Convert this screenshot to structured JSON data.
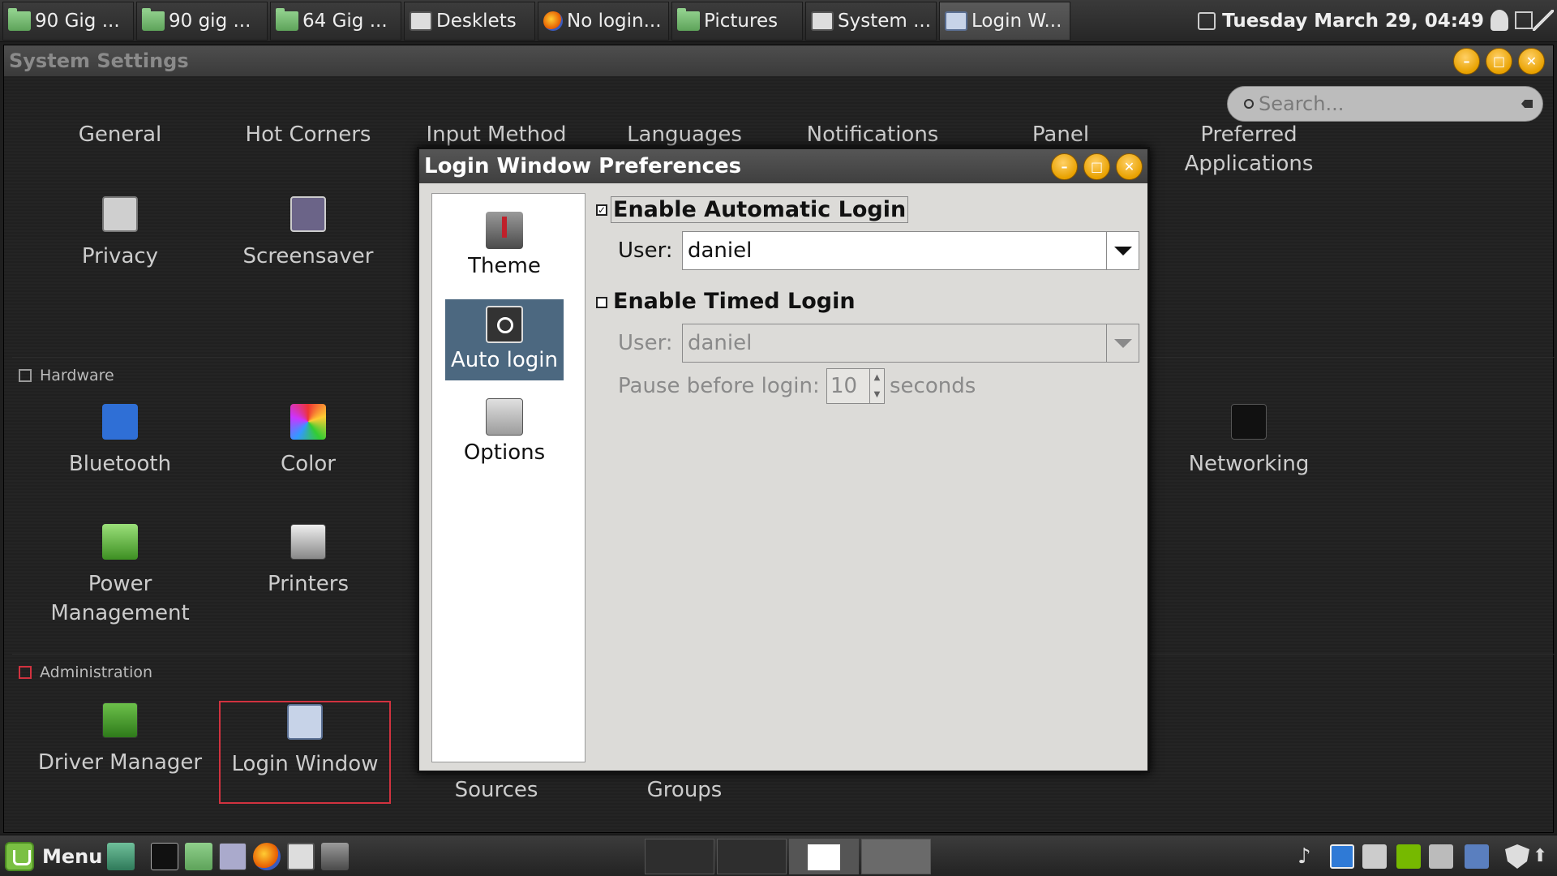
{
  "taskbar": {
    "tasks": [
      {
        "label": "90 Gig ...",
        "icon": "folder-icon"
      },
      {
        "label": "90 gig ...",
        "icon": "folder-icon"
      },
      {
        "label": "64 Gig ...",
        "icon": "folder-icon"
      },
      {
        "label": "Desklets",
        "icon": "settings-icon"
      },
      {
        "label": "No login...",
        "icon": "firefox-icon"
      },
      {
        "label": "Pictures",
        "icon": "folder-icon"
      },
      {
        "label": "System ...",
        "icon": "settings-icon"
      },
      {
        "label": "Login W...",
        "icon": "login-window-icon"
      }
    ],
    "clock": "Tuesday March 29, 04:49"
  },
  "settings": {
    "title": "System Settings",
    "search_placeholder": "Search...",
    "top_items": [
      "General",
      "Hot Corners",
      "Input Method",
      "Languages",
      "Notifications",
      "Panel",
      "Preferred Applications"
    ],
    "row2": [
      "Privacy",
      "Screensaver"
    ],
    "hardware_label": "Hardware",
    "hardware": [
      "Bluetooth",
      "Color",
      "Networking",
      "Power Management",
      "Printers"
    ],
    "admin_label": "Administration",
    "admin": [
      "Driver Manager",
      "Login Window",
      "Sources",
      "Groups"
    ]
  },
  "dialog": {
    "title": "Login Window Preferences",
    "sidebar": [
      "Theme",
      "Auto login",
      "Options"
    ],
    "auto_login_label": "Enable Automatic Login",
    "auto_login_checked": true,
    "user_label": "User:",
    "auto_user": "daniel",
    "timed_login_label": "Enable Timed Login",
    "timed_login_checked": false,
    "timed_user": "daniel",
    "pause_label": "Pause before login:",
    "pause_value": "10",
    "seconds_label": "seconds"
  },
  "panel": {
    "menu_label": "Menu"
  },
  "colors": {
    "accent_selected": "#4c6880",
    "highlight_border": "#d1323f",
    "window_button": "#e8a100"
  }
}
